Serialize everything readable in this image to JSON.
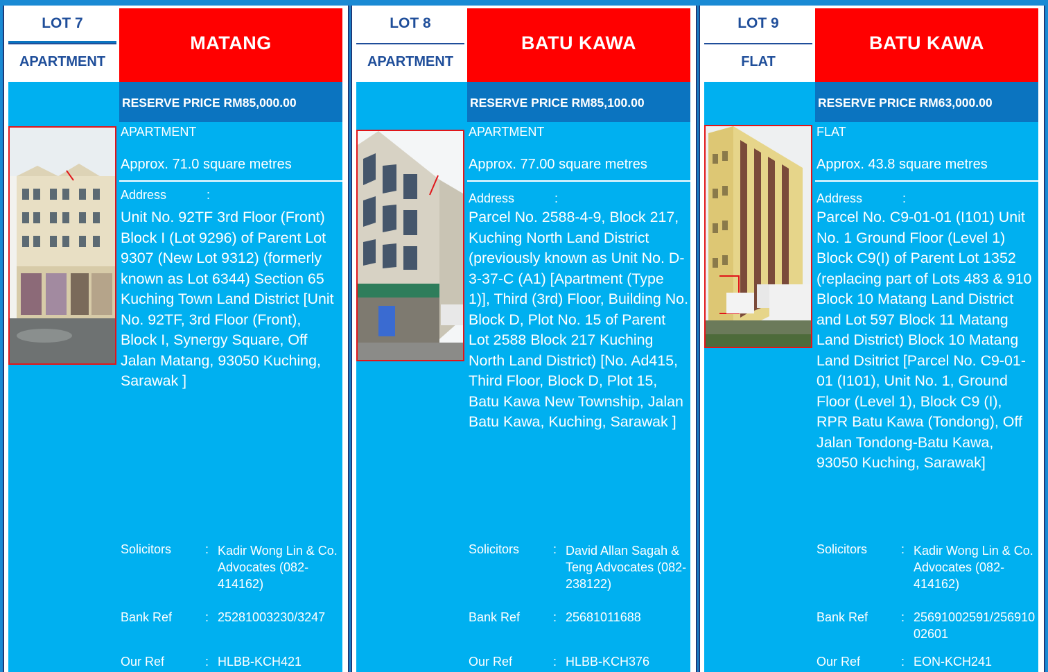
{
  "lots": [
    {
      "lot": "LOT 7",
      "type_header": "APARTMENT",
      "location": "MATANG",
      "reserve_price": "RESERVE PRICE RM85,000.00",
      "property_type": "APARTMENT",
      "area": "Approx. 71.0 square metres",
      "address_label": "Address",
      "address": "Unit No. 92TF 3rd Floor (Front) Block I (Lot 9296) of Parent Lot 9307 (New Lot 9312) (formerly known as Lot 6344) Section 65 Kuching Town Land District [Unit No. 92TF, 3rd Floor (Front), Block I, Synergy Square, Off Jalan Matang, 93050 Kuching, Sarawak ]",
      "solicitors_label": "Solicitors",
      "solicitors": "Kadir Wong Lin & Co. Advocates (082-414162)",
      "bank_ref_label": "Bank Ref",
      "bank_ref": "25281003230/3247",
      "our_ref_label": "Our Ref",
      "our_ref": "HLBB-KCH421"
    },
    {
      "lot": "LOT 8",
      "type_header": "APARTMENT",
      "location": "BATU KAWA",
      "reserve_price": "RESERVE PRICE RM85,100.00",
      "property_type": "APARTMENT",
      "area": "Approx. 77.00 square metres",
      "address_label": "Address",
      "address": "Parcel No. 2588-4-9, Block 217, Kuching North Land District (previously known as Unit No. D-3-37-C (A1) [Apartment (Type 1)], Third (3rd) Floor, Building No. Block D, Plot No. 15 of Parent Lot 2588 Block 217 Kuching North Land District) [No. Ad415, Third Floor, Block D, Plot 15, Batu Kawa New Township, Jalan Batu Kawa, Kuching, Sarawak ]",
      "solicitors_label": "Solicitors",
      "solicitors": "David Allan Sagah & Teng Advocates (082-238122)",
      "bank_ref_label": "Bank Ref",
      "bank_ref": "25681011688",
      "our_ref_label": "Our Ref",
      "our_ref": "HLBB-KCH376"
    },
    {
      "lot": "LOT 9",
      "type_header": "FLAT",
      "location": "BATU KAWA",
      "reserve_price": "RESERVE PRICE RM63,000.00",
      "property_type": "FLAT",
      "area": "Approx. 43.8 square metres",
      "address_label": "Address",
      "address": "Parcel No. C9-01-01 (I101) Unit No. 1 Ground Floor (Level 1) Block C9(I) of Parent Lot 1352 (replacing part of Lots 483 & 910 Block 10 Matang Land District and Lot 597 Block 11 Matang Land District) Block 10 Matang Land Dsitrict [Parcel No. C9-01-01 (I101), Unit No. 1, Ground Floor (Level 1), Block C9 (I), RPR Batu Kawa (Tondong), Off Jalan Tondong-Batu Kawa, 93050 Kuching, Sarawak]",
      "solicitors_label": "Solicitors",
      "solicitors": "Kadir Wong Lin & Co. Advocates (082-414162)",
      "bank_ref_label": "Bank Ref",
      "bank_ref": "25691002591/25691002601",
      "our_ref_label": "Our Ref",
      "our_ref": "EON-KCH241"
    }
  ],
  "colon": ":",
  "colors": {
    "header_red": "#ff0000",
    "dark_blue": "#0b74c0",
    "cyan": "#00b0f0",
    "photo_border": "#e0161a"
  }
}
